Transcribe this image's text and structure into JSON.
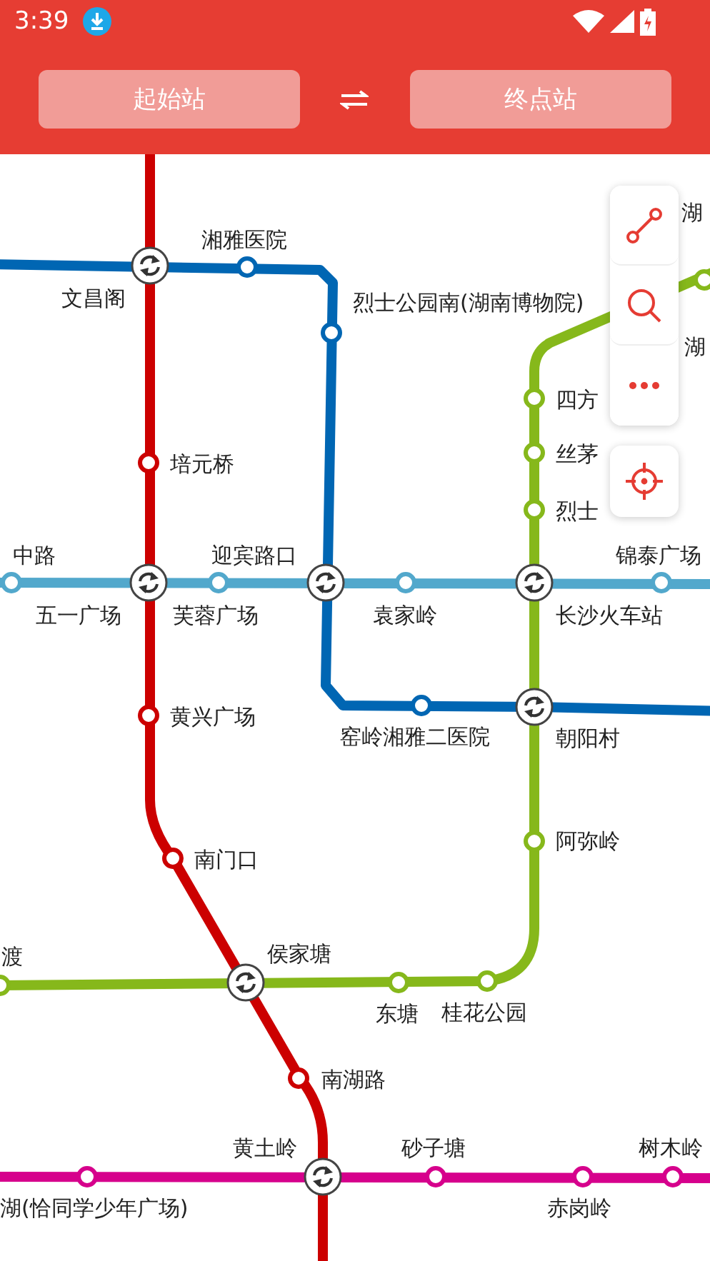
{
  "status_bar": {
    "time": "3:39"
  },
  "route_bar": {
    "start": {
      "placeholder": "起始站"
    },
    "end": {
      "placeholder": "终点站"
    }
  },
  "lines": [
    {
      "color": "#cc0000"
    },
    {
      "color": "#0066b3"
    },
    {
      "color": "#52a8cc"
    },
    {
      "color": "#86b81b"
    },
    {
      "color": "#d6008c"
    }
  ],
  "stations": [
    {
      "name": "湖",
      "kind": "label_only"
    },
    {
      "name": "湘雅医院",
      "kind": "station",
      "color": "#0066b3"
    },
    {
      "name": "文昌阁",
      "kind": "interchange"
    },
    {
      "name": "烈士公园南(湖南博物院)",
      "kind": "station",
      "color": "#0066b3"
    },
    {
      "name": "湖",
      "kind": "label_only"
    },
    {
      "name": "四方",
      "kind": "station",
      "color": "#86b81b"
    },
    {
      "name": "培元桥",
      "kind": "station",
      "color": "#cc0000"
    },
    {
      "name": "丝茅",
      "kind": "station",
      "color": "#86b81b"
    },
    {
      "name": "烈士",
      "kind": "station",
      "color": "#86b81b"
    },
    {
      "name": "中路",
      "kind": "station",
      "color": "#52a8cc"
    },
    {
      "name": "迎宾路口",
      "kind": "interchange"
    },
    {
      "name": "锦泰广场",
      "kind": "station",
      "color": "#52a8cc"
    },
    {
      "name": "五一广场",
      "kind": "interchange"
    },
    {
      "name": "芙蓉广场",
      "kind": "station",
      "color": "#52a8cc"
    },
    {
      "name": "袁家岭",
      "kind": "station",
      "color": "#52a8cc"
    },
    {
      "name": "长沙火车站",
      "kind": "interchange"
    },
    {
      "name": "黄兴广场",
      "kind": "station",
      "color": "#cc0000"
    },
    {
      "name": "窑岭湘雅二医院",
      "kind": "station",
      "color": "#0066b3"
    },
    {
      "name": "朝阳村",
      "kind": "interchange"
    },
    {
      "name": "南门口",
      "kind": "station",
      "color": "#cc0000"
    },
    {
      "name": "阿弥岭",
      "kind": "station",
      "color": "#86b81b"
    },
    {
      "name": "渡",
      "kind": "station",
      "color": "#86b81b"
    },
    {
      "name": "侯家塘",
      "kind": "interchange"
    },
    {
      "name": "东塘",
      "kind": "station",
      "color": "#86b81b"
    },
    {
      "name": "桂花公园",
      "kind": "station",
      "color": "#86b81b"
    },
    {
      "name": "南湖路",
      "kind": "station",
      "color": "#cc0000"
    },
    {
      "name": "黄土岭",
      "kind": "interchange"
    },
    {
      "name": "砂子塘",
      "kind": "station",
      "color": "#d6008c"
    },
    {
      "name": "树木岭",
      "kind": "station",
      "color": "#d6008c"
    },
    {
      "name": "湖(恰同学少年广场)",
      "kind": "station",
      "color": "#d6008c"
    },
    {
      "name": "赤岗岭",
      "kind": "station",
      "color": "#d6008c"
    }
  ]
}
